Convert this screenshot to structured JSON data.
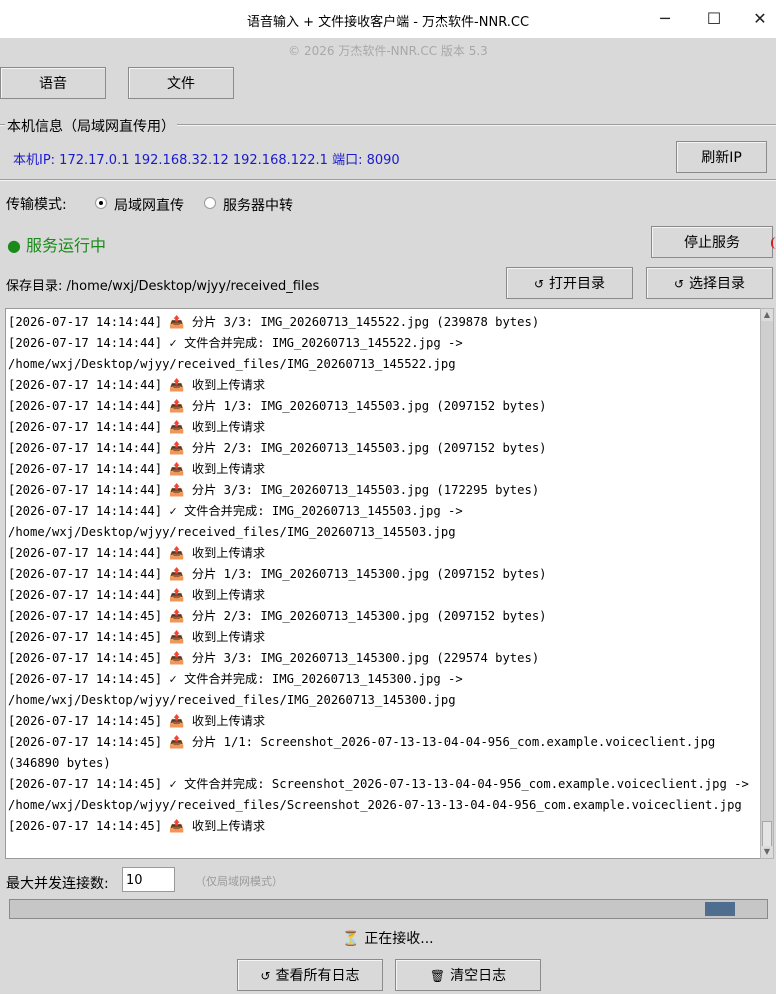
{
  "window": {
    "title": "语音输入 + 文件接收客户端 - 万杰软件-NNR.CC",
    "minimize": "─",
    "maximize": "☐",
    "close": "✕"
  },
  "copyright": "© 2026 万杰软件-NNR.CC  版本 5.3",
  "tabs": {
    "voice": "语音",
    "file": "文件"
  },
  "local_info": {
    "group_label": "本机信息（局域网直传用）",
    "ip_text": "本机IP: 172.17.0.1 192.168.32.12 192.168.122.1  端口: 8090",
    "refresh_button": "刷新IP"
  },
  "transfer_mode": {
    "label": "传输模式:",
    "options": [
      "局域网直传",
      "服务器中转"
    ],
    "selected": "局域网直传"
  },
  "service": {
    "status": "● 服务运行中",
    "stop_button": "停止服务",
    "status_color": "#1a8a1a"
  },
  "save_dir": {
    "label": "保存目录: /home/wxj/Desktop/wjyy/received_files",
    "open_button": "打开目录",
    "choose_button": "选择目录",
    "open_icon": "↺",
    "choose_icon": "↺"
  },
  "log": {
    "lines": [
      "[2026-07-17 14:14:44] 📤 分片 3/3: IMG_20260713_145522.jpg (239878 bytes)",
      "[2026-07-17 14:14:44] ✓ 文件合并完成: IMG_20260713_145522.jpg ->",
      "/home/wxj/Desktop/wjyy/received_files/IMG_20260713_145522.jpg",
      "[2026-07-17 14:14:44] 📤 收到上传请求",
      "[2026-07-17 14:14:44] 📤 分片 1/3: IMG_20260713_145503.jpg (2097152 bytes)",
      "[2026-07-17 14:14:44] 📤 收到上传请求",
      "[2026-07-17 14:14:44] 📤 分片 2/3: IMG_20260713_145503.jpg (2097152 bytes)",
      "[2026-07-17 14:14:44] 📤 收到上传请求",
      "[2026-07-17 14:14:44] 📤 分片 3/3: IMG_20260713_145503.jpg (172295 bytes)",
      "[2026-07-17 14:14:44] ✓ 文件合并完成: IMG_20260713_145503.jpg ->",
      "/home/wxj/Desktop/wjyy/received_files/IMG_20260713_145503.jpg",
      "[2026-07-17 14:14:44] 📤 收到上传请求",
      "[2026-07-17 14:14:44] 📤 分片 1/3: IMG_20260713_145300.jpg (2097152 bytes)",
      "[2026-07-17 14:14:44] 📤 收到上传请求",
      "[2026-07-17 14:14:45] 📤 分片 2/3: IMG_20260713_145300.jpg (2097152 bytes)",
      "[2026-07-17 14:14:45] 📤 收到上传请求",
      "[2026-07-17 14:14:45] 📤 分片 3/3: IMG_20260713_145300.jpg (229574 bytes)",
      "[2026-07-17 14:14:45] ✓ 文件合并完成: IMG_20260713_145300.jpg ->",
      "/home/wxj/Desktop/wjyy/received_files/IMG_20260713_145300.jpg",
      "[2026-07-17 14:14:45] 📤 收到上传请求",
      "[2026-07-17 14:14:45] 📤 分片 1/1: Screenshot_2026-07-13-13-04-04-956_com.example.voiceclient.jpg",
      "(346890 bytes)",
      "[2026-07-17 14:14:45] ✓ 文件合并完成: Screenshot_2026-07-13-13-04-04-956_com.example.voiceclient.jpg ->",
      "/home/wxj/Desktop/wjyy/received_files/Screenshot_2026-07-13-13-04-04-956_com.example.voiceclient.jpg",
      "[2026-07-17 14:14:45] 📤 收到上传请求"
    ]
  },
  "max_conn": {
    "label": "最大并发连接数:",
    "value": "10",
    "hint": "（仅局域网模式）"
  },
  "progress": {
    "value": 0.96
  },
  "receiving_text": "⏳ 正在接收...",
  "footer": {
    "view_logs": "查看所有日志",
    "clear_logs": "清空日志",
    "view_icon": "↺",
    "clear_icon": "🗑"
  }
}
